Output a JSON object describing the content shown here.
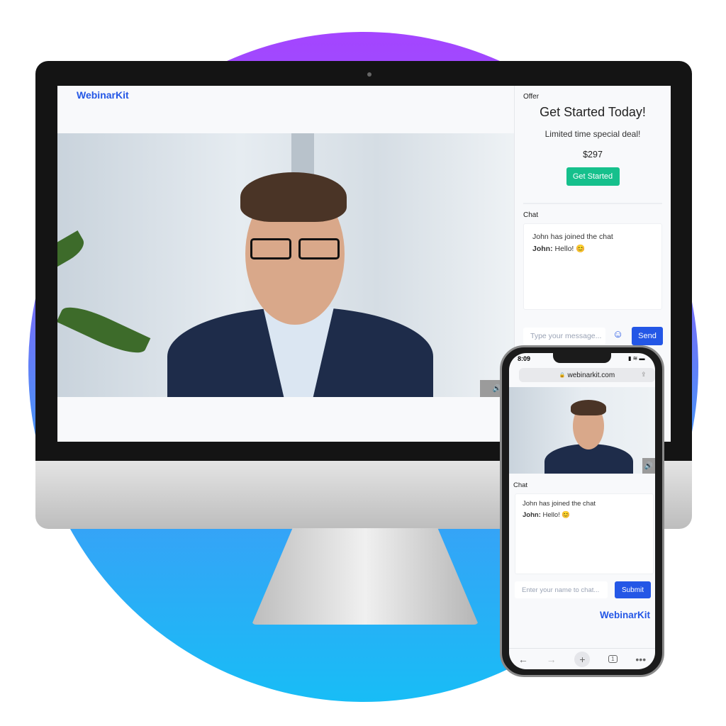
{
  "colors": {
    "brand": "#2457e6",
    "cta": "#16c08c",
    "circle_top": "#a445ff",
    "circle_bottom": "#18bdf6"
  },
  "desktop": {
    "logo": "WebinarKit",
    "offer": {
      "section_label": "Offer",
      "title": "Get Started Today!",
      "subtitle": "Limited time special deal!",
      "price": "$297",
      "cta_label": "Get Started"
    },
    "chat": {
      "section_label": "Chat",
      "messages": [
        {
          "text": "John has joined the chat"
        },
        {
          "author": "John:",
          "text": "Hello! 😊"
        }
      ],
      "input_placeholder": "Type your message...",
      "emoji_icon": "smiley-icon",
      "send_label": "Send"
    },
    "volume_icon": "speaker-icon"
  },
  "phone": {
    "time": "8:09",
    "url": "webinarkit.com",
    "chat": {
      "section_label": "Chat",
      "messages": [
        {
          "text": "John has joined the chat"
        },
        {
          "author": "John:",
          "text": "Hello! 😊"
        }
      ],
      "input_placeholder": "Enter your name to chat...",
      "submit_label": "Submit"
    },
    "logo": "WebinarKit",
    "toolbar": {
      "tabs_count": "1"
    }
  }
}
